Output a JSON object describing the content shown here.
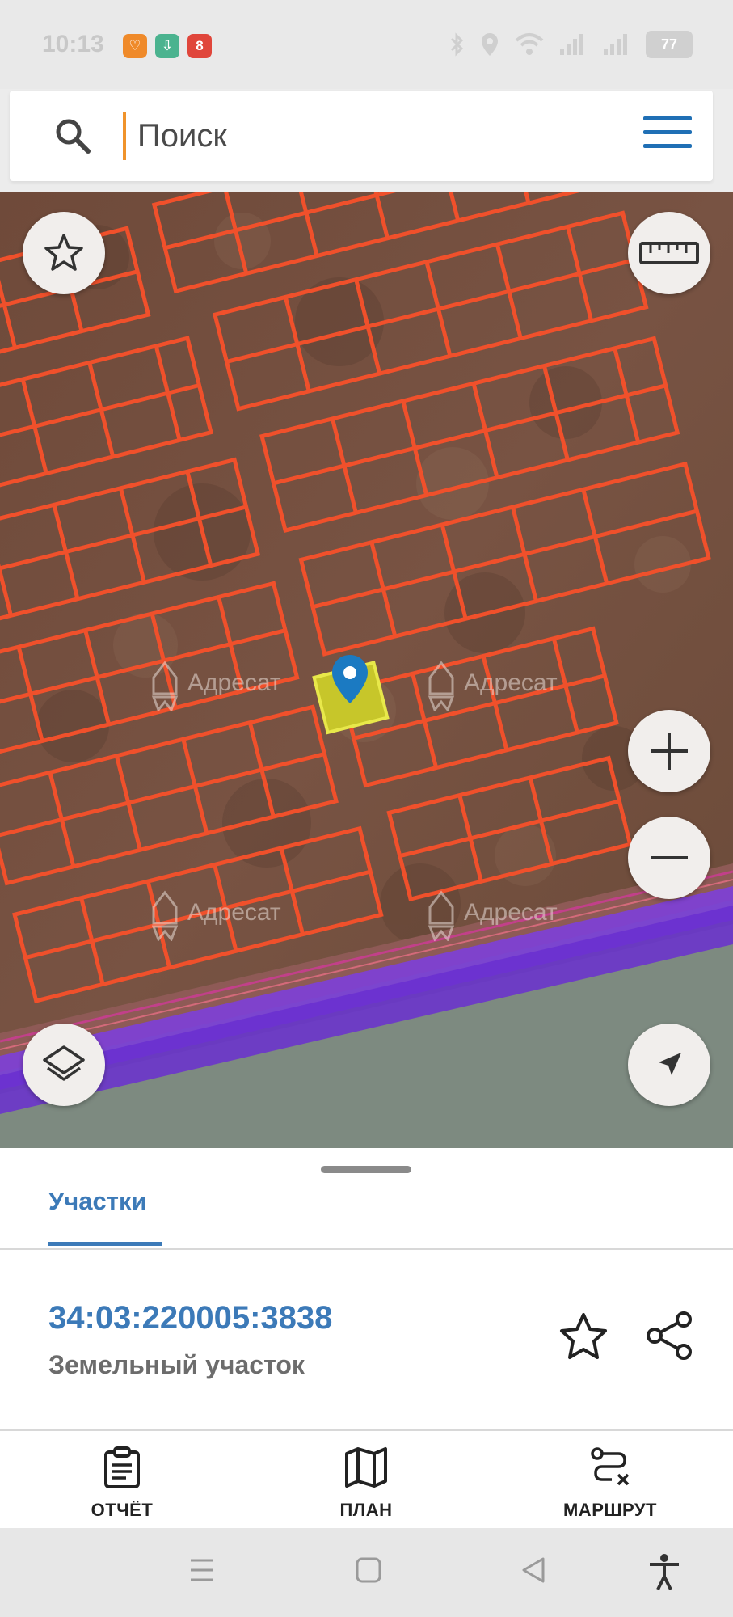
{
  "status_bar": {
    "time": "10:13",
    "notifications": [
      {
        "name": "app-notification-orange-icon",
        "color": "#ef8a2a",
        "glyph": "♡"
      },
      {
        "name": "download-notification-icon",
        "color": "#4bb38f",
        "glyph": "⇩"
      },
      {
        "name": "app-notification-red-icon",
        "color": "#e0463b",
        "glyph": "8"
      }
    ],
    "battery": "77"
  },
  "search": {
    "placeholder": "Поиск"
  },
  "map": {
    "watermarks": [
      "Адресат",
      "Адресат",
      "Адресат",
      "Адресат"
    ],
    "colors": {
      "parcel_outline": "#f0502b",
      "selected_parcel": "#c7c62a",
      "marker": "#1b7ac2",
      "road": "#7d3fd9"
    }
  },
  "sheet": {
    "tab_label": "Участки",
    "parcel_number": "34:03:220005:3838",
    "parcel_type": "Земельный участок",
    "actions": [
      {
        "label": "ОТЧЁТ",
        "icon": "clipboard-icon"
      },
      {
        "label": "ПЛАН",
        "icon": "map-icon"
      },
      {
        "label": "МАРШРУТ",
        "icon": "route-icon"
      }
    ]
  }
}
